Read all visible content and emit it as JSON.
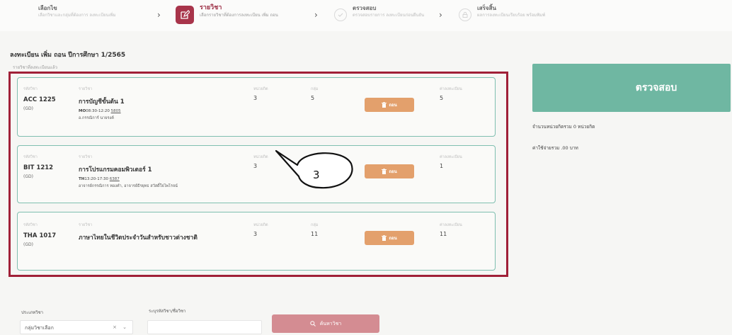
{
  "stepper": {
    "steps": [
      {
        "title": "เลือกไข",
        "sub": "เลือกวิชาและกลุ่มที่ต้องการ ลงทะเบียนเพิ่ม",
        "state": "done"
      },
      {
        "title": "รายวิชา",
        "sub": "เลือกรายวิชาที่ต้องการลงทะเบียน เพิ่ม ถอน",
        "state": "active"
      },
      {
        "title": "ตรวจสอบ",
        "sub": "ตรวจสอบรายการ ลงทะเบียนก่อนยืนยัน",
        "state": "pending"
      },
      {
        "title": "เสร็จสิ้น",
        "sub": "ผลการลงทะเบียนเรียบร้อย พร้อมพิมพ์",
        "state": "pending"
      }
    ],
    "chevron": "›"
  },
  "page": {
    "title": "ลงทะเบียน เพิ่ม ถอน ปีการศึกษา 1/2565",
    "subtitle": "รายวิชาที่ลงทะเบียนแล้ว"
  },
  "columns": {
    "code": "รหัสวิชา",
    "name": "รายวิชา",
    "credit": "หน่วยกิต",
    "group": "กลุ่ม",
    "fee": "ค่าลงทะเบียน"
  },
  "courses": [
    {
      "code": "ACC 1225",
      "group_tag": "(GD)",
      "name": "การบัญชีขั้นต้น 1",
      "time_day": "MO",
      "time_range": "08:30-12:20",
      "room": "5805",
      "teacher": "อ.กรรณิการ์ นายรงค์",
      "credit": "3",
      "group": "5",
      "fee": "5"
    },
    {
      "code": "BIT 1212",
      "group_tag": "(GD)",
      "name": "การโปรแกรมคอมพิวเตอร์ 1",
      "time_day": "TH",
      "time_range": "13:20-17:30",
      "room": "6387",
      "teacher": "อาจารย์กรรณิการ ทองคำ, อาจารย์ธีรยุทธ สวัสดิ์ใจไพโรจน์",
      "credit": "3",
      "group": "1",
      "fee": "1"
    },
    {
      "code": "THA 1017",
      "group_tag": "(GD)",
      "name": "ภาษาไทยในชีวิตประจำวันสำหรับชาวต่างชาติ",
      "time_day": "",
      "time_range": "",
      "room": "",
      "teacher": "",
      "credit": "3",
      "group": "11",
      "fee": "11"
    }
  ],
  "delete_label": "ถอน",
  "panel": {
    "check_label": "ตรวจสอบ",
    "credits_text": "จำนวนหน่วยกิตรวม 0 หน่วยกิต",
    "fee_text": "ค่าใช้จ่ายรวม .00 บาท"
  },
  "callout": {
    "number": "3"
  },
  "search": {
    "type_label": "ประเภทวิชา",
    "type_value": "กลุ่มวิชาเลือก",
    "clear": "×",
    "dropdown": "⌄",
    "keyword_label": "ระบุรหัสวิชา/ชื่อวิชา",
    "keyword_value": "",
    "search_label": "ค้นหาวิชา"
  },
  "colors": {
    "accent": "#a8344a",
    "frame": "#a02038",
    "card_border": "#7fbfb0",
    "check_button": "#6fb7a2",
    "delete_button": "#e3a06c",
    "search_button": "#d48c92"
  }
}
